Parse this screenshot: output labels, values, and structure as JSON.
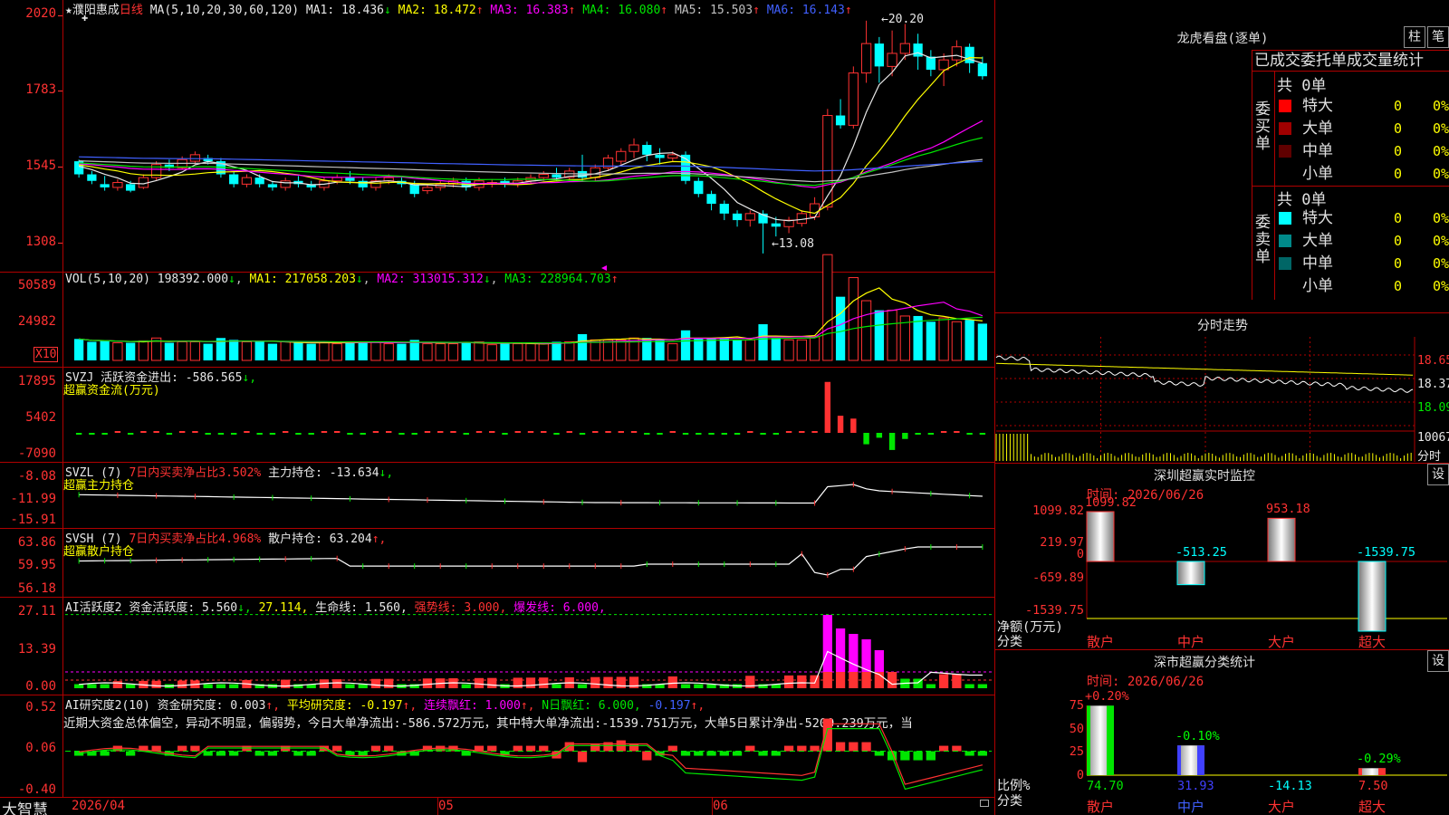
{
  "stock": {
    "star": "★",
    "name": "濮阳惠成",
    "period": "日线"
  },
  "ma_header": {
    "params": "MA(5,10,20,30,60,120)",
    "items": [
      {
        "label": "MA1:",
        "value": "18.436",
        "arrow": "↓",
        "color": "#e8e8e8"
      },
      {
        "label": "MA2:",
        "value": "18.472",
        "arrow": "↑",
        "color": "#ffff00"
      },
      {
        "label": "MA3:",
        "value": "16.383",
        "arrow": "↑",
        "color": "#ff00ff"
      },
      {
        "label": "MA4:",
        "value": "16.080",
        "arrow": "↑",
        "color": "#00e600"
      },
      {
        "label": "MA5:",
        "value": "15.503",
        "arrow": "↑",
        "color": "#c0c0c0"
      },
      {
        "label": "MA6:",
        "value": "16.143",
        "arrow": "↑",
        "color": "#4060ff"
      }
    ]
  },
  "price_axis": [
    "2020",
    "1783",
    "1545",
    "1308"
  ],
  "price_marks": {
    "high": "20.20",
    "low": "13.08"
  },
  "vol_header": {
    "params": "VOL(5,10,20)",
    "vol": "198392.000",
    "vol_arrow": "↓",
    "ma1": "MA1: 217058.203",
    "ma1_arrow": "↓",
    "ma2": "MA2: 313015.312",
    "ma2_arrow": "↓",
    "ma3": "MA3: 228964.703",
    "ma3_arrow": "↑"
  },
  "vol_axis": [
    "50589",
    "24982"
  ],
  "vol_unit": "X10",
  "svzj": {
    "name": "SVZJ",
    "label": "活跃资金进出:",
    "value": "-586.565",
    "arrow": "↓,",
    "subtitle": "超赢资金流(万元)",
    "axis": [
      "17895",
      "5402",
      "-7090"
    ]
  },
  "svzl": {
    "name": "SVZL (7)",
    "ratio": "7日内买卖净占比3.502%",
    "label": "主力持仓:",
    "value": "-13.634",
    "arrow": "↓,",
    "subtitle": "超赢主力持仓",
    "axis": [
      "-8.08",
      "-11.99",
      "-15.91"
    ]
  },
  "svsh": {
    "name": "SVSH (7)",
    "ratio": "7日内买卖净占比4.968%",
    "label": "散户持仓:",
    "value": "63.204",
    "arrow": "↑,",
    "subtitle": "超赢散户持仓",
    "axis": [
      "63.86",
      "59.95",
      "56.18"
    ]
  },
  "ai_active": {
    "name": "AI活跃度2",
    "label": "资金活跃度:",
    "value": "5.560",
    "arrow": "↓,",
    "v2": "27.114,",
    "life_label": "生命线:",
    "life": "1.560,",
    "strong": "强势线: 3.000,",
    "burst": "爆发线: 6.000,",
    "axis": [
      "27.11",
      "13.39",
      "0.00"
    ]
  },
  "ai_research": {
    "name": "AI研究度2(10)",
    "label": "资金研究度:",
    "value": "0.003",
    "arrow": "↑,",
    "avg": "平均研究度: -0.197",
    "avg_arrow": "↑,",
    "red_line": "连续飘红: 1.000",
    "red_arrow": "↑,",
    "nred": "N日飘红: 6.000,",
    "last": "-0.197",
    "last_arrow": "↑,",
    "axis": [
      "0.52",
      "0.06",
      "-0.40"
    ],
    "comment": "近期大资金总体偏空，异动不明显，偏弱势，今日大单净流出:-586.572万元，其中特大单净流出:-1539.751万元，大单5日累计净出-5200.239万元，当"
  },
  "date_axis": [
    "2026/04",
    "05",
    "06"
  ],
  "brand": "大智慧",
  "right": {
    "lhb_title": "龙虎看盘(逐单)",
    "tab_zhu": "柱",
    "tab_bi": "笔",
    "stats_title": "已成交委托单成交量统计",
    "buy": {
      "side": "委买单",
      "total": "共 0单",
      "rows": [
        {
          "label": "特大",
          "count": "0",
          "pct": "0%",
          "color": "#ff0000"
        },
        {
          "label": "大单",
          "count": "0",
          "pct": "0%",
          "color": "#a00000"
        },
        {
          "label": "中单",
          "count": "0",
          "pct": "0%",
          "color": "#600000"
        },
        {
          "label": "小单",
          "count": "0",
          "pct": "0%",
          "color": "#000000"
        }
      ]
    },
    "sell": {
      "side": "委卖单",
      "total": "共 0单",
      "rows": [
        {
          "label": "特大",
          "count": "0",
          "pct": "0%",
          "color": "#00ffff"
        },
        {
          "label": "大单",
          "count": "0",
          "pct": "0%",
          "color": "#008a8a"
        },
        {
          "label": "中单",
          "count": "0",
          "pct": "0%",
          "color": "#006666"
        },
        {
          "label": "小单",
          "count": "0",
          "pct": "0%",
          "color": "#000000"
        }
      ]
    },
    "intraday_title": "分时走势",
    "intraday_axis": [
      "18.65",
      "18.37",
      "18.09",
      "10067"
    ],
    "intraday_tag": "分时",
    "monitor_title": "深圳超赢实时监控",
    "monitor_set": "设",
    "monitor_time": "时间: 2026/06/26",
    "monitor_axis": [
      "1099.82",
      "219.97",
      "0",
      "-659.89",
      "-1539.75"
    ],
    "monitor_unit": "净额(万元)",
    "monitor_cat": "分类",
    "monitor_bars": [
      {
        "name": "散户",
        "value": "1099.82"
      },
      {
        "name": "中户",
        "value": "-513.25"
      },
      {
        "name": "大户",
        "value": "953.18"
      },
      {
        "name": "超大",
        "value": "-1539.75"
      }
    ],
    "class_title": "深市超赢分类统计",
    "class_set": "设",
    "class_time": "时间: 2026/06/26",
    "class_axis": [
      "75",
      "50",
      "25",
      "0"
    ],
    "class_unit": "比例%",
    "class_cat": "分类",
    "class_bars": [
      {
        "name": "散户",
        "value": "74.70",
        "change": "+0.20%"
      },
      {
        "name": "中户",
        "value": "31.93",
        "change": "-0.10%"
      },
      {
        "name": "大户",
        "value": "-14.13",
        "change": ""
      },
      {
        "name": "超大",
        "value": "7.50",
        "change": "-0.29%"
      }
    ]
  },
  "chart_data": {
    "type": "candlestick",
    "title": "濮阳惠成 日线",
    "ylim": [
      13.08,
      20.2
    ],
    "candles": [
      [
        15.9,
        15.5,
        15.95,
        15.4
      ],
      [
        15.5,
        15.3,
        15.6,
        15.2
      ],
      [
        15.2,
        15.1,
        15.45,
        15.0
      ],
      [
        15.1,
        15.25,
        15.35,
        15.0
      ],
      [
        15.2,
        15.0,
        15.3,
        14.95
      ],
      [
        15.1,
        15.4,
        15.5,
        15.05
      ],
      [
        15.4,
        15.8,
        15.9,
        15.3
      ],
      [
        15.8,
        15.7,
        15.95,
        15.6
      ],
      [
        15.7,
        15.95,
        16.05,
        15.65
      ],
      [
        15.9,
        16.1,
        16.2,
        15.8
      ],
      [
        16.0,
        15.9,
        16.1,
        15.8
      ],
      [
        15.9,
        15.5,
        16.0,
        15.4
      ],
      [
        15.5,
        15.2,
        15.6,
        15.1
      ],
      [
        15.2,
        15.4,
        15.5,
        15.1
      ],
      [
        15.4,
        15.2,
        15.5,
        15.1
      ],
      [
        15.2,
        15.1,
        15.3,
        15.0
      ],
      [
        15.1,
        15.3,
        15.4,
        15.0
      ],
      [
        15.3,
        15.2,
        15.45,
        15.1
      ],
      [
        15.2,
        15.1,
        15.3,
        15.0
      ],
      [
        15.1,
        15.3,
        15.4,
        15.0
      ],
      [
        15.3,
        15.4,
        15.5,
        15.2
      ],
      [
        15.4,
        15.3,
        15.6,
        15.2
      ],
      [
        15.3,
        15.1,
        15.4,
        15.0
      ],
      [
        15.1,
        15.3,
        15.4,
        15.0
      ],
      [
        15.3,
        15.4,
        15.5,
        15.2
      ],
      [
        15.3,
        15.2,
        15.4,
        15.1
      ],
      [
        15.2,
        14.9,
        15.3,
        14.8
      ],
      [
        15.0,
        15.1,
        15.2,
        14.9
      ],
      [
        15.1,
        15.2,
        15.3,
        15.0
      ],
      [
        15.2,
        15.3,
        15.4,
        15.1
      ],
      [
        15.3,
        15.1,
        15.4,
        15.0
      ],
      [
        15.1,
        15.3,
        15.4,
        15.0
      ],
      [
        15.2,
        15.25,
        15.35,
        15.1
      ],
      [
        15.3,
        15.2,
        15.4,
        15.1
      ],
      [
        15.2,
        15.3,
        15.4,
        15.1
      ],
      [
        15.3,
        15.4,
        15.5,
        15.2
      ],
      [
        15.4,
        15.5,
        15.6,
        15.3
      ],
      [
        15.5,
        15.4,
        15.7,
        15.3
      ],
      [
        15.4,
        15.6,
        15.7,
        15.3
      ],
      [
        15.6,
        15.4,
        16.1,
        15.3
      ],
      [
        15.4,
        15.7,
        15.8,
        15.3
      ],
      [
        15.7,
        16.0,
        16.1,
        15.6
      ],
      [
        15.9,
        16.2,
        16.3,
        15.8
      ],
      [
        16.2,
        16.4,
        16.6,
        16.0
      ],
      [
        16.4,
        16.1,
        16.5,
        15.9
      ],
      [
        16.1,
        16.0,
        16.3,
        15.8
      ],
      [
        16.0,
        16.1,
        16.2,
        15.9
      ],
      [
        16.1,
        15.3,
        16.2,
        15.2
      ],
      [
        15.3,
        14.9,
        15.4,
        14.8
      ],
      [
        14.9,
        14.6,
        15.0,
        14.4
      ],
      [
        14.6,
        14.3,
        14.7,
        14.1
      ],
      [
        14.3,
        14.1,
        14.4,
        13.9
      ],
      [
        14.1,
        14.3,
        14.4,
        13.9
      ],
      [
        14.3,
        14.0,
        14.4,
        13.08
      ],
      [
        14.0,
        13.9,
        14.2,
        13.6
      ],
      [
        13.9,
        14.1,
        14.2,
        13.7
      ],
      [
        14.0,
        14.3,
        14.4,
        13.9
      ],
      [
        14.2,
        14.6,
        14.8,
        14.1
      ],
      [
        14.5,
        17.3,
        17.5,
        14.4
      ],
      [
        17.3,
        17.0,
        17.8,
        16.9
      ],
      [
        17.0,
        18.6,
        18.8,
        16.9
      ],
      [
        18.6,
        19.5,
        20.2,
        18.3
      ],
      [
        19.5,
        18.8,
        19.7,
        18.3
      ],
      [
        18.8,
        19.2,
        19.9,
        18.5
      ],
      [
        19.2,
        19.5,
        20.1,
        19.0
      ],
      [
        19.5,
        19.1,
        19.8,
        18.7
      ],
      [
        19.1,
        18.7,
        19.3,
        18.5
      ],
      [
        18.7,
        19.0,
        19.2,
        18.2
      ],
      [
        19.0,
        19.4,
        19.6,
        18.8
      ],
      [
        19.4,
        18.9,
        19.5,
        18.6
      ],
      [
        18.9,
        18.5,
        19.1,
        18.4
      ]
    ]
  }
}
